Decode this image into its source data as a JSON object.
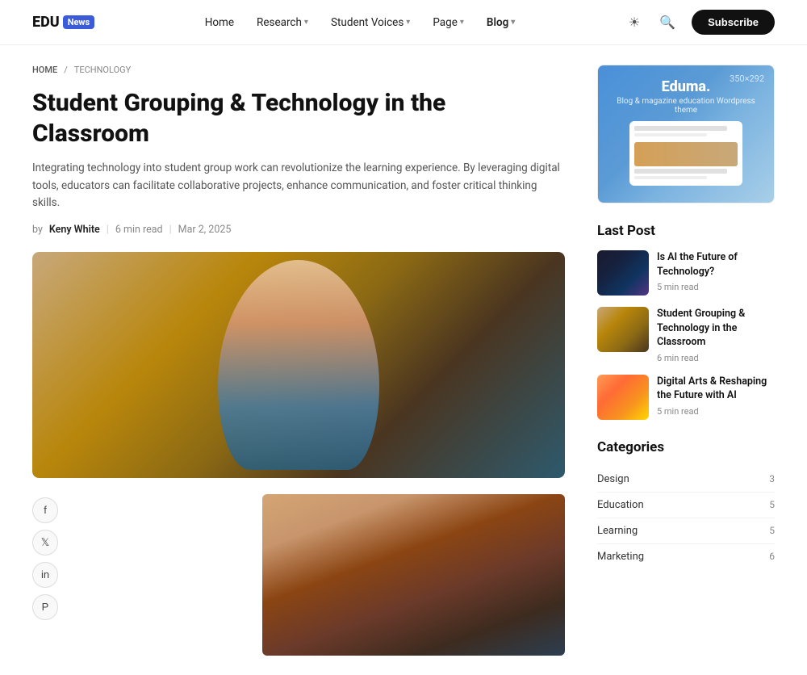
{
  "header": {
    "logo_edu": "EDU",
    "logo_badge": "News",
    "nav_items": [
      {
        "label": "Home",
        "has_dropdown": false
      },
      {
        "label": "Research",
        "has_dropdown": true
      },
      {
        "label": "Student Voices",
        "has_dropdown": true
      },
      {
        "label": "Page",
        "has_dropdown": true
      },
      {
        "label": "Blog",
        "has_dropdown": true,
        "active": true
      }
    ],
    "subscribe_label": "Subscribe"
  },
  "breadcrumb": {
    "home": "HOME",
    "separator": "/",
    "current": "TECHNOLOGY"
  },
  "article": {
    "title": "Student Grouping & Technology in the Classroom",
    "excerpt": "Integrating technology into student group work can revolutionize the learning experience. By leveraging digital tools, educators can facilitate collaborative projects, enhance communication, and foster critical thinking skills.",
    "author_prefix": "by",
    "author": "Keny White",
    "read_time": "6 min read",
    "separator": "|",
    "date": "Mar 2, 2025"
  },
  "social": {
    "facebook": "f",
    "twitter": "𝕏",
    "linkedin": "in",
    "pinterest": "P"
  },
  "sidebar": {
    "ad": {
      "logo": "Eduma.",
      "subtitle": "Blog & magazine education Wordpress theme",
      "dimensions": "350×292"
    },
    "last_post_title": "Last Post",
    "posts": [
      {
        "title": "Is AI the Future of Technology?",
        "read_time": "5 min read",
        "thumb_class": "post-thumb-1"
      },
      {
        "title": "Student Grouping & Technology in the Classroom",
        "read_time": "6 min read",
        "thumb_class": "post-thumb-2"
      },
      {
        "title": "Digital Arts & Reshaping the Future with AI",
        "read_time": "5 min read",
        "thumb_class": "post-thumb-3"
      }
    ],
    "categories_title": "Categories",
    "categories": [
      {
        "name": "Design",
        "count": 3
      },
      {
        "name": "Education",
        "count": 5
      },
      {
        "name": "Learning",
        "count": 5
      },
      {
        "name": "Marketing",
        "count": 6
      }
    ]
  }
}
